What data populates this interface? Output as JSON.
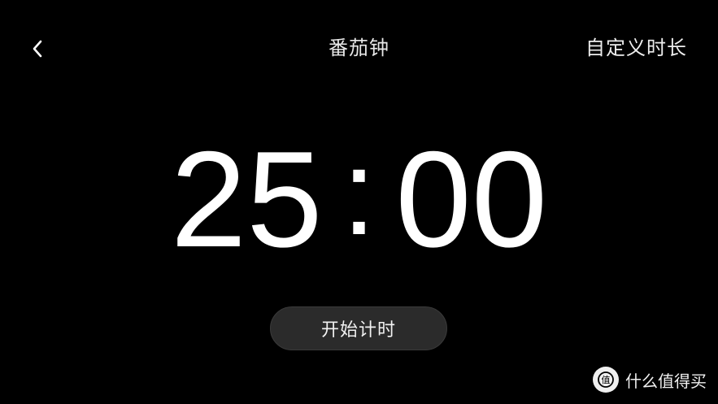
{
  "header": {
    "title": "番茄钟",
    "custom_duration_label": "自定义时长"
  },
  "timer": {
    "minutes": "25",
    "separator": ":",
    "seconds": "00"
  },
  "actions": {
    "start_label": "开始计时"
  },
  "watermark": {
    "text": "什么值得买"
  },
  "colors": {
    "background": "#000000",
    "text": "#ffffff",
    "button_bg": "#2b2b2b"
  },
  "icons": {
    "back": "chevron-left-icon",
    "watermark_logo": "smzdm-logo-icon"
  }
}
